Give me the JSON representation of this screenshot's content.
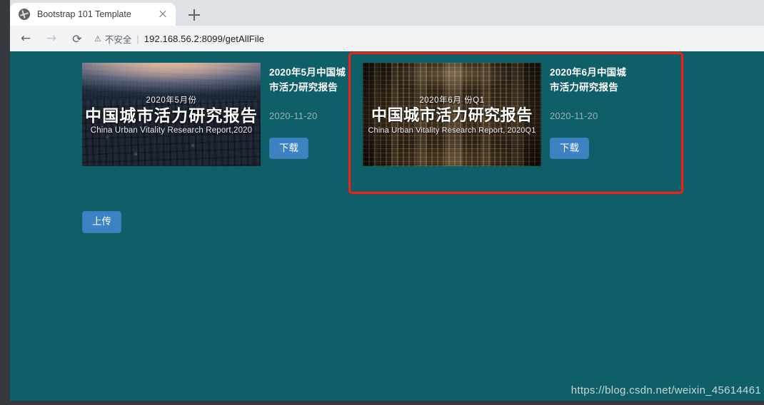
{
  "browser": {
    "tab": {
      "title": "Bootstrap 101 Template",
      "favicon": "globe-icon",
      "close": "close-icon"
    },
    "newtab_label": "+",
    "nav": {
      "back": "←",
      "forward": "→",
      "reload": "⟳"
    },
    "omnibox": {
      "warning_icon": "⚠",
      "warning_text": "不安全",
      "separator": "|",
      "url_host": "192.168.56.2",
      "url_rest": ":8099/getAllFile",
      "url_full": "192.168.56.2:8099/getAllFile"
    }
  },
  "page": {
    "background_color": "#0f5f69",
    "upload_button": "上传",
    "watermark": "https://blog.csdn.net/weixin_45614461",
    "highlight_color": "#fd1c13",
    "cards": [
      {
        "id": "card-may-2020",
        "title": "2020年5月中国城市活力研究报告",
        "date": "2020-11-20",
        "download_label": "下载",
        "thumbnail": {
          "kicker": "2020年5月份",
          "title": "中国城市活力研究报告",
          "subtitle": "China Urban Vitality Research Report,2020"
        },
        "highlighted": false
      },
      {
        "id": "card-june-2020",
        "title": "2020年6月中国城市活力研究报告",
        "date": "2020-11-20",
        "download_label": "下载",
        "thumbnail": {
          "kicker": "2020年6月 份Q1",
          "title": "中国城市活力研究报告",
          "subtitle": "China Urban Vitality Research Report, 2020Q1"
        },
        "highlighted": true
      }
    ]
  }
}
